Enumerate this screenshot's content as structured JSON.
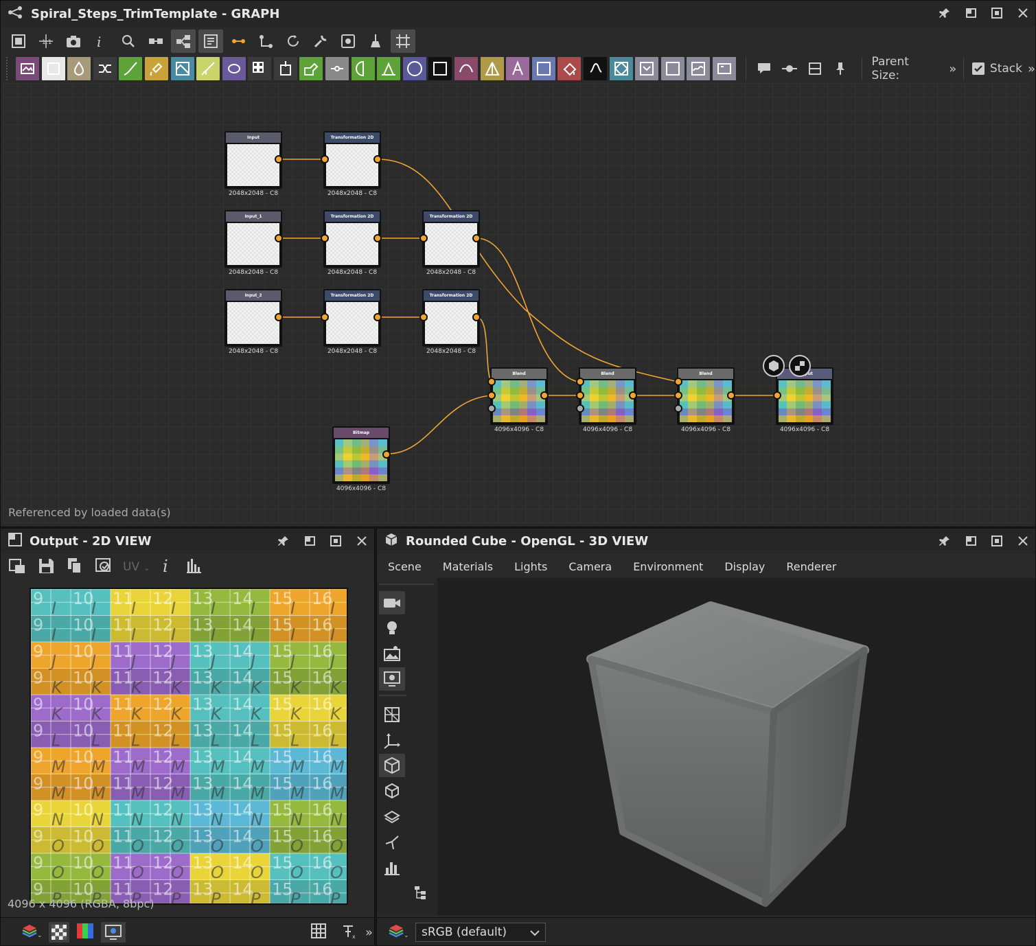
{
  "graph_panel": {
    "title": "Spiral_Steps_TrimTemplate - GRAPH",
    "parent_size_label": "Parent Size:",
    "stack_label": "Stack",
    "status": "Referenced by loaded data(s)",
    "tool_colors": [
      "#7a4a78",
      "#e8e8e8",
      "#a69a7a",
      "#3a3a3a",
      "#5ea33a",
      "#c9a33a",
      "#4a8aa3",
      "#c9d46a",
      "#6a5a9a",
      "#3a3a3a",
      "#3a3a3a",
      "#5ea33a",
      "#8a8a8a",
      "#5ea33a",
      "#5ea33a",
      "#5a5a9a",
      "#111111",
      "#8a4a6a",
      "#b09a4a",
      "#9a6a9a",
      "#6a7ab0",
      "#aa4a4a",
      "#111111",
      "#4a8a9a",
      "#8a8a9a",
      "#8a8a9a",
      "#8a8a9a",
      "#8a8a9a"
    ],
    "nodes": [
      {
        "id": "n1",
        "title": "Input",
        "label": "2048x2048 - C8",
        "header": "#5a5a6a"
      },
      {
        "id": "n2",
        "title": "Transformation 2D",
        "label": "2048x2048 - C8",
        "header": "#3d4a6a"
      },
      {
        "id": "n3",
        "title": "Input_1",
        "label": "2048x2048 - C8",
        "header": "#5a5a6a"
      },
      {
        "id": "n4",
        "title": "Transformation 2D",
        "label": "2048x2048 - C8",
        "header": "#3d4a6a"
      },
      {
        "id": "n5",
        "title": "Transformation 2D",
        "label": "2048x2048 - C8",
        "header": "#3d4a6a"
      },
      {
        "id": "n6",
        "title": "Input_2",
        "label": "2048x2048 - C8",
        "header": "#5a5a6a"
      },
      {
        "id": "n7",
        "title": "Transformation 2D",
        "label": "2048x2048 - C8",
        "header": "#3d4a6a"
      },
      {
        "id": "n8",
        "title": "Transformation 2D",
        "label": "2048x2048 - C8",
        "header": "#3d4a6a"
      },
      {
        "id": "n9",
        "title": "Blend",
        "label": "4096x4096 - C8",
        "header": "#6a6a6a"
      },
      {
        "id": "n10",
        "title": "Blend",
        "label": "4096x4096 - C8",
        "header": "#6a6a6a"
      },
      {
        "id": "n11",
        "title": "Blend",
        "label": "4096x4096 - C8",
        "header": "#6a6a6a"
      },
      {
        "id": "n12",
        "title": "Output",
        "label": "4096x4096 - C8",
        "header": "#5a5a7a"
      },
      {
        "id": "n13",
        "title": "Bitmap",
        "label": "4096x4096 - C8",
        "header": "#6a4a6a"
      }
    ]
  },
  "view2d": {
    "title": "Output - 2D VIEW",
    "uv_label": "UV",
    "info": "4096 x 4096 (RGBA, 8bpc)",
    "grid_numbers": [
      "9",
      "10",
      "11",
      "12",
      "13",
      "14",
      "15",
      "16"
    ],
    "grid_letters": [
      "I",
      "J",
      "K",
      "L",
      "M",
      "N",
      "O",
      "P"
    ]
  },
  "view3d": {
    "title": "Rounded Cube - OpenGL - 3D VIEW",
    "menu": [
      "Scene",
      "Materials",
      "Lights",
      "Camera",
      "Environment",
      "Display",
      "Renderer"
    ],
    "colorspace": "sRGB (default)"
  }
}
